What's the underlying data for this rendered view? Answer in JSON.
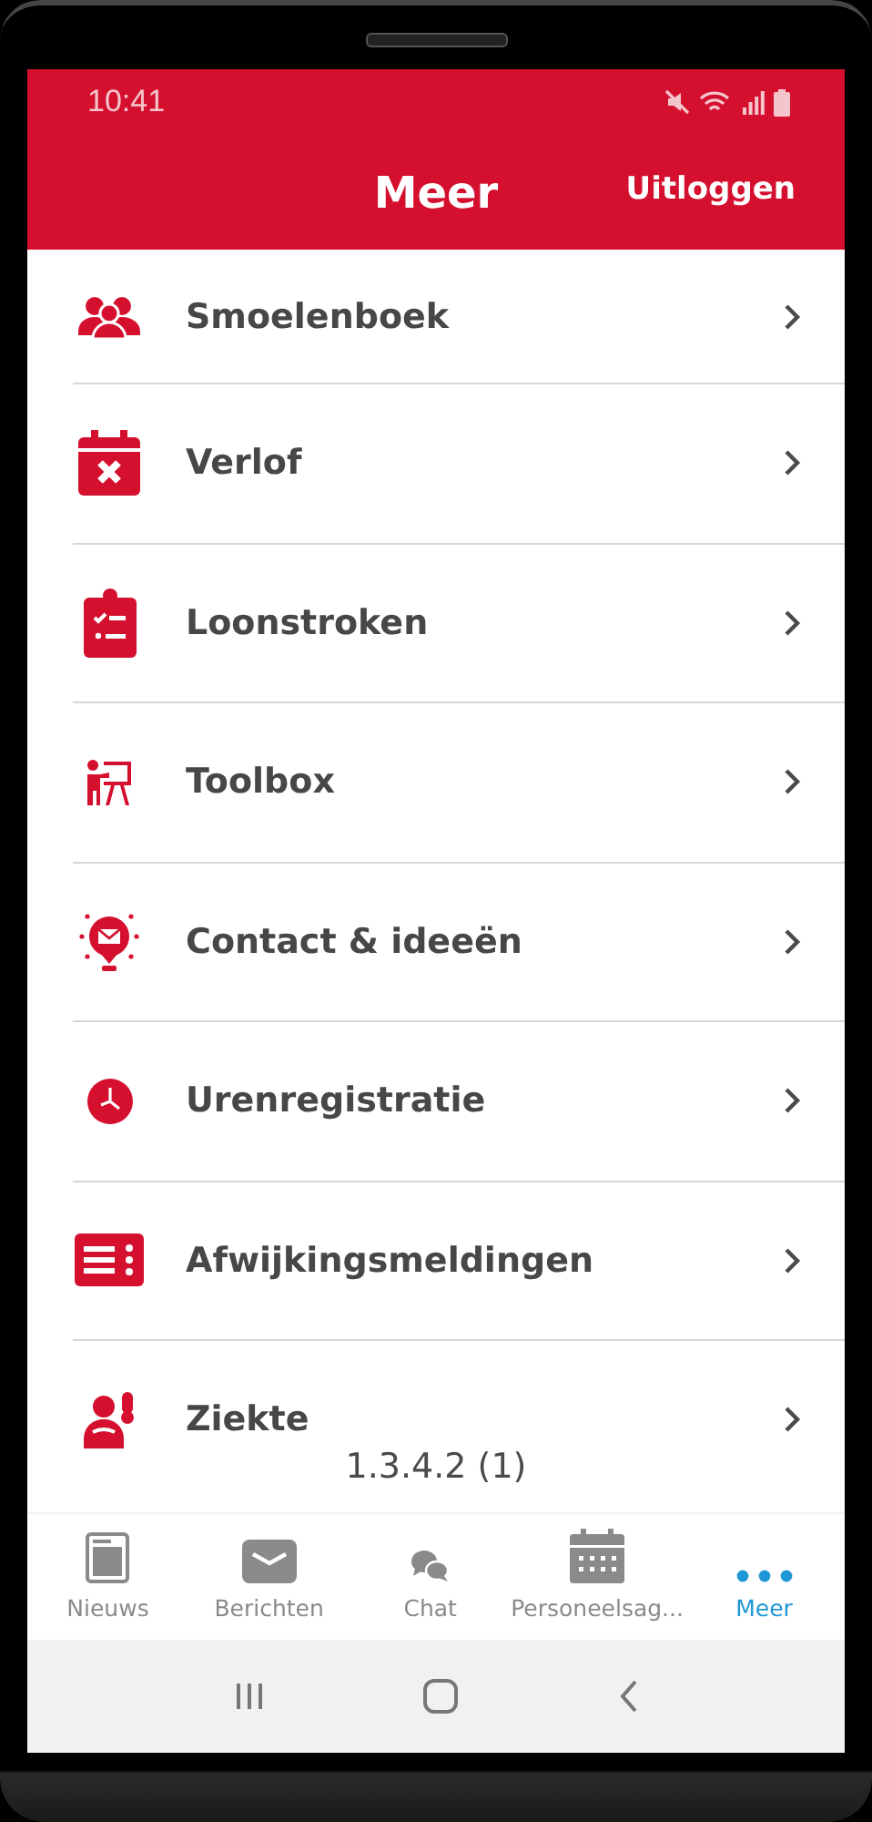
{
  "status_bar": {
    "time": "10:41"
  },
  "header": {
    "title": "Meer",
    "action": "Uitloggen"
  },
  "menu_items": [
    {
      "kind": "people",
      "label": "Smoelenboek"
    },
    {
      "kind": "calendar-x",
      "label": "Verlof"
    },
    {
      "kind": "clipboard",
      "label": "Loonstroken"
    },
    {
      "kind": "presenter",
      "label": "Toolbox"
    },
    {
      "kind": "bulb",
      "label": "Contact & ideeën"
    },
    {
      "kind": "clock",
      "label": "Urenregistratie"
    },
    {
      "kind": "list",
      "label": "Afwijkingsmeldingen"
    },
    {
      "kind": "sick",
      "label": "Ziekte"
    }
  ],
  "version": "1.3.4.2 (1)",
  "tabs": [
    {
      "kind": "news",
      "label": "Nieuws",
      "selected": false
    },
    {
      "kind": "mail",
      "label": "Berichten",
      "selected": false
    },
    {
      "kind": "chat",
      "label": "Chat",
      "selected": false
    },
    {
      "kind": "calendar",
      "label": "Personeelsag...",
      "selected": false
    },
    {
      "kind": "dots",
      "label": "Meer",
      "selected": true
    }
  ]
}
